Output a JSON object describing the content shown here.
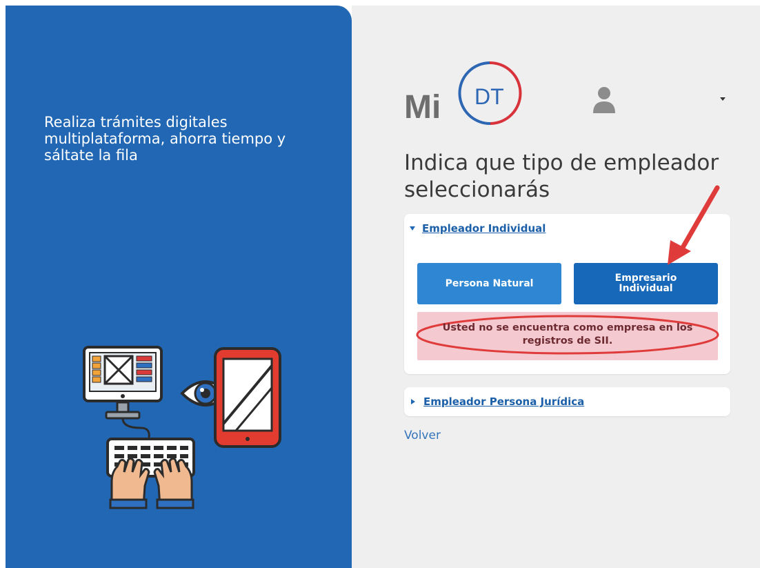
{
  "left": {
    "tagline": "Realiza trámites digitales multiplataforma, ahorra tiempo y sáltate la fila"
  },
  "logo": {
    "prefix": "Mi",
    "badge": "DT"
  },
  "heading": "Indica que tipo de empleador seleccionarás",
  "accordion": {
    "individual": {
      "label": "Empleador Individual",
      "buttons": {
        "natural": "Persona Natural",
        "empresario": "Empresario Individual"
      },
      "alert": "Usted no se encuentra como empresa en los registros de SII."
    },
    "juridica": {
      "label": "Empleador Persona Jurídica"
    }
  },
  "volver": "Volver",
  "colors": {
    "primary_blue": "#2167b4",
    "button_light": "#2f86d2",
    "button_dark": "#1768b8",
    "alert_bg": "#f4c9cf",
    "annotation_red": "#e03b3b"
  },
  "icons": [
    "user-icon",
    "caret-down-icon",
    "caret-right-icon",
    "computer-illustration",
    "eye-icon",
    "tablet-icon",
    "keyboard-icon"
  ]
}
